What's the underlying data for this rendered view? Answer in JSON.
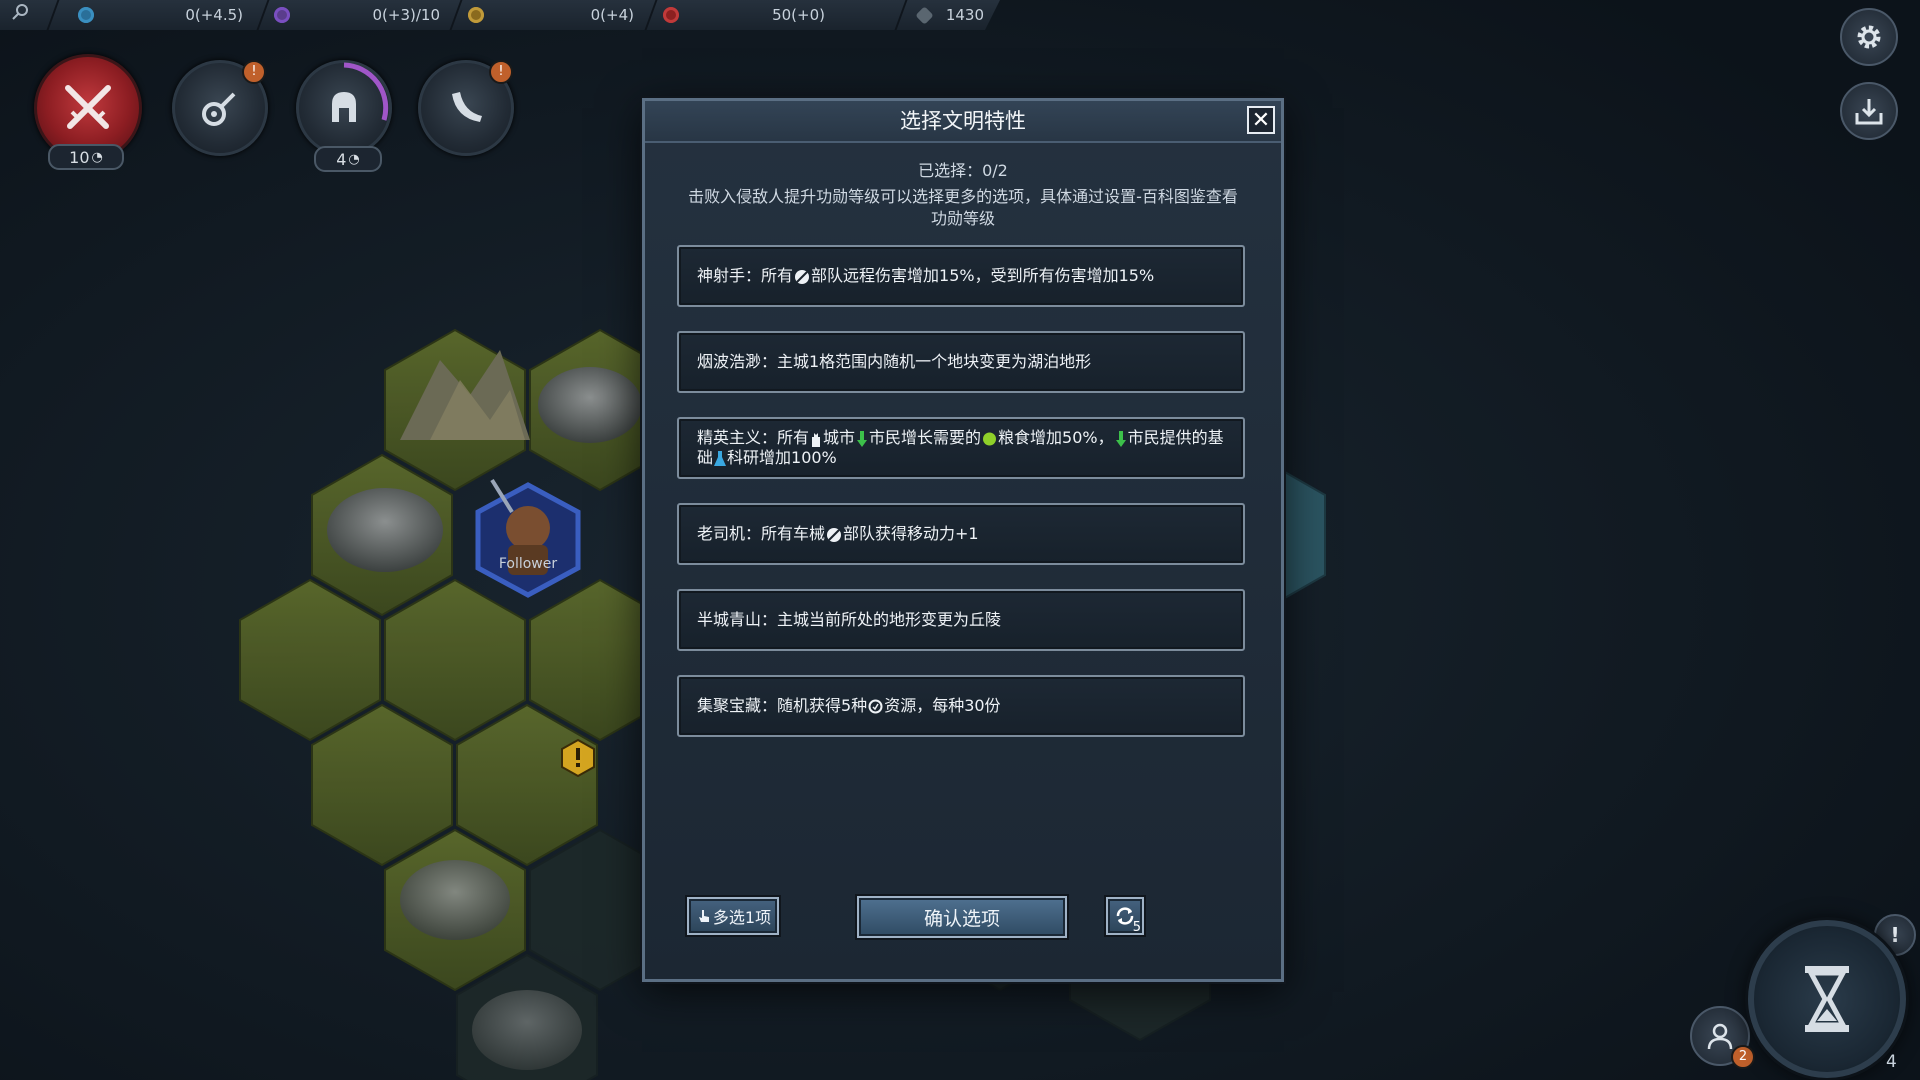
{
  "resources": [
    {
      "name": "science",
      "icon": "flask-icon",
      "value": "0(+4.5)",
      "color": "#3a8fc0"
    },
    {
      "name": "culture",
      "icon": "star-icon",
      "value": "0(+3)/10",
      "color": "#7a4fc0"
    },
    {
      "name": "gold",
      "icon": "coin-icon",
      "value": "0(+4)",
      "color": "#c09a3a"
    },
    {
      "name": "faith",
      "icon": "helmet-icon",
      "value": "50(+0)",
      "color": "#c03a3a"
    },
    {
      "name": "military",
      "icon": "gem-icon",
      "value": "1430",
      "color": "#9aa8b4"
    }
  ],
  "abilities": {
    "attack_cost": "10",
    "helmet_cost": "4",
    "guitar_badge": "!",
    "horn_badge": "!"
  },
  "map": {
    "unit_label": "Follower"
  },
  "dialog": {
    "title": "选择文明特性",
    "close_label": "✕",
    "selected": "已选择：0/2",
    "hint": "击败入侵敌人提升功勋等级可以选择更多的选项，具体通过设置-百科图鉴查看功勋等级",
    "options": {
      "o1": {
        "a": "神射手：所有",
        "b": "部队远程伤害增加15%，受到所有伤害增加15%"
      },
      "o2": {
        "a": "烟波浩渺：主城1格范围内随机一个地块变更为湖泊地形"
      },
      "o3": {
        "a": "精英主义：所有",
        "b": "城市",
        "c": "市民增长需要的",
        "d": "粮食增加50%，",
        "e": "市民提供的基础",
        "f": "科研增加100%"
      },
      "o4": {
        "a": "老司机：所有车械",
        "b": "部队获得移动力+1"
      },
      "o5": {
        "a": "半城青山：主城当前所处的地形变更为丘陵"
      },
      "o6": {
        "a": "集聚宝藏：随机获得5种",
        "b": "资源，每种30份"
      }
    },
    "multi_button": "多选1项",
    "confirm_button": "确认选项",
    "refresh_count": "5"
  },
  "endturn": {
    "alert_badge": "!",
    "social_badge": "2",
    "turn": "4"
  }
}
